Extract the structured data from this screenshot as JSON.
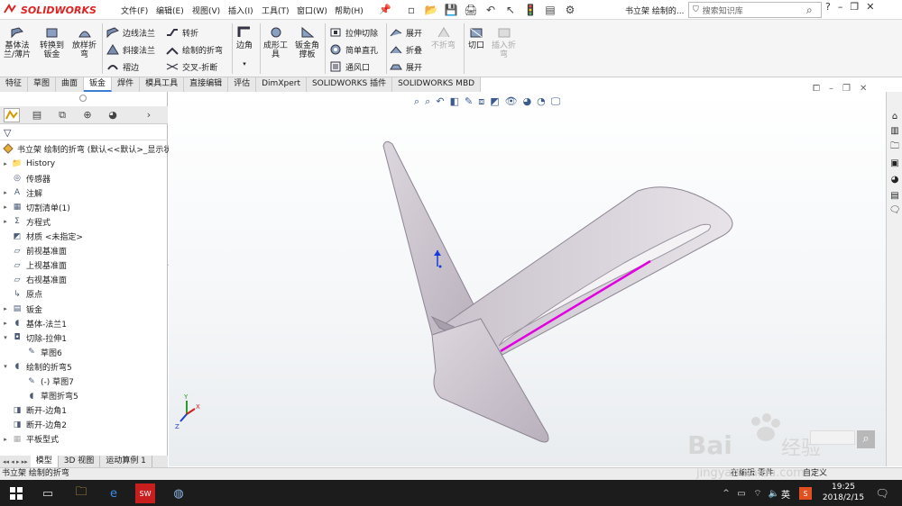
{
  "app": {
    "logo_text": "SOLIDWORKS",
    "doc_title": "书立架 绘制的..."
  },
  "menu": [
    "文件(F)",
    "编辑(E)",
    "视图(V)",
    "插入(I)",
    "工具(T)",
    "窗口(W)",
    "帮助(H)"
  ],
  "search": {
    "placeholder": "搜索知识库"
  },
  "ribbon": {
    "big": [
      {
        "label": "基体法\n兰/薄片"
      },
      {
        "label": "转换到\n钣金"
      },
      {
        "label": "放样折\n弯"
      },
      {
        "label": "边角"
      },
      {
        "label": "成形工\n具"
      },
      {
        "label": "钣金角\n撑板"
      },
      {
        "label": "不折弯",
        "disabled": true
      },
      {
        "label": "切口"
      },
      {
        "label": "插入折\n弯",
        "disabled": true
      }
    ],
    "small": [
      {
        "label": "边线法兰"
      },
      {
        "label": "斜接法兰"
      },
      {
        "label": "褶边"
      },
      {
        "label": "转折"
      },
      {
        "label": "绘制的折弯"
      },
      {
        "label": "交叉-折断"
      },
      {
        "label": "拉伸切除"
      },
      {
        "label": "简单直孔"
      },
      {
        "label": "通风口"
      },
      {
        "label": "展开"
      },
      {
        "label": "折叠"
      },
      {
        "label": "展开"
      }
    ]
  },
  "tabs": [
    "特征",
    "草图",
    "曲面",
    "钣金",
    "焊件",
    "模具工具",
    "直接编辑",
    "评估",
    "DimXpert",
    "SOLIDWORKS 插件",
    "SOLIDWORKS MBD"
  ],
  "active_tab": "钣金",
  "tree": {
    "root": "书立架 绘制的折弯 (默认<<默认>_显示状",
    "items": [
      {
        "label": "History",
        "arrow": "▸",
        "indent": 0
      },
      {
        "label": "传感器",
        "arrow": "",
        "indent": 0
      },
      {
        "label": "注解",
        "arrow": "▸",
        "indent": 0
      },
      {
        "label": "切割清单(1)",
        "arrow": "▸",
        "indent": 0
      },
      {
        "label": "方程式",
        "arrow": "▸",
        "indent": 0
      },
      {
        "label": "材质 <未指定>",
        "arrow": "",
        "indent": 0
      },
      {
        "label": "前视基准面",
        "arrow": "",
        "indent": 0
      },
      {
        "label": "上视基准面",
        "arrow": "",
        "indent": 0
      },
      {
        "label": "右视基准面",
        "arrow": "",
        "indent": 0
      },
      {
        "label": "原点",
        "arrow": "",
        "indent": 0
      },
      {
        "label": "钣金",
        "arrow": "▸",
        "indent": 0
      },
      {
        "label": "基体-法兰1",
        "arrow": "▸",
        "indent": 0
      },
      {
        "label": "切除-拉伸1",
        "arrow": "▾",
        "indent": 0
      },
      {
        "label": "草图6",
        "arrow": "",
        "indent": 1
      },
      {
        "label": "绘制的折弯5",
        "arrow": "▾",
        "indent": 0
      },
      {
        "label": "(-) 草图7",
        "arrow": "",
        "indent": 1
      },
      {
        "label": "草图折弯5",
        "arrow": "",
        "indent": 1
      },
      {
        "label": "断开-边角1",
        "arrow": "",
        "indent": 0
      },
      {
        "label": "断开-边角2",
        "arrow": "",
        "indent": 0
      },
      {
        "label": "平板型式",
        "arrow": "▸",
        "indent": 0,
        "disabled": true
      }
    ]
  },
  "bottom_tabs": [
    "模型",
    "3D 视图",
    "运动算例 1"
  ],
  "status": "书立架 绘制的折弯",
  "status_right": [
    "在编辑 零件",
    "自定义"
  ],
  "taskbar": {
    "time": "19:25",
    "date": "2018/2/15",
    "ime": "英"
  },
  "watermark": {
    "brand": "Bai",
    "brand2": "经验",
    "url": "jingyan.baidu.com"
  },
  "colors": {
    "logo": "#dd2222",
    "tab_active": "#3a7fd5",
    "edge_highlight": "#e000e0",
    "part_fill": "#c9c2cc",
    "taskbar": "#1c1c1c"
  }
}
